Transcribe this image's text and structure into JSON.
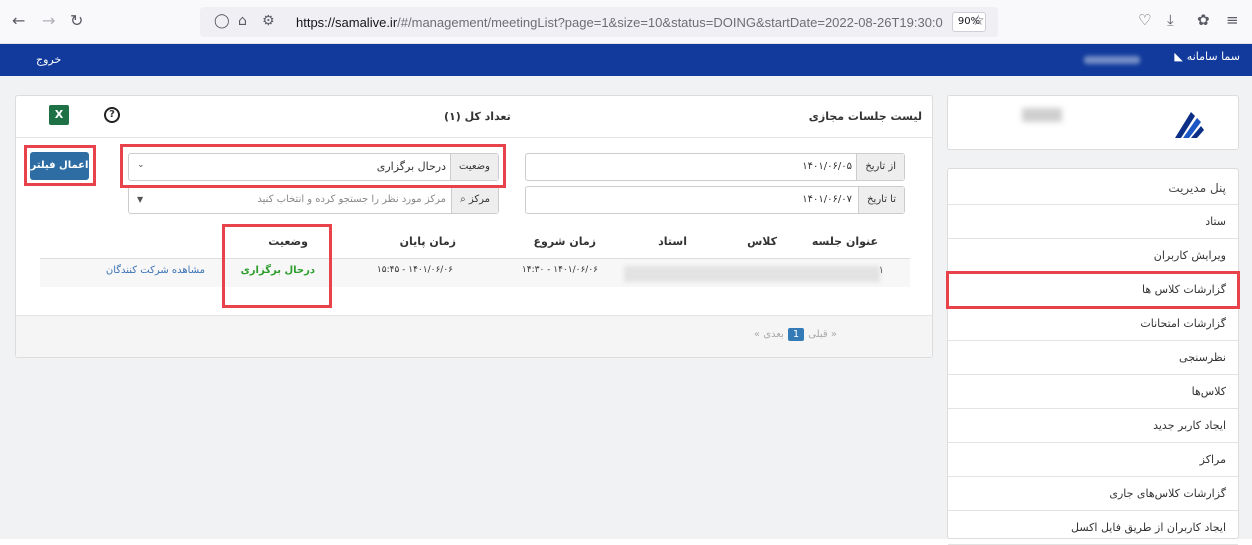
{
  "browser": {
    "url_host": "https://samalive.ir",
    "url_rest": "/#/management/meetingList?page=1&size=10&status=DOING&startDate=2022-08-26T19:30:0",
    "zoom": "90%"
  },
  "topbar": {
    "logout": "خروج",
    "brand": "سما سامانه"
  },
  "sidebar": {
    "items": [
      {
        "label": "پنل مدیریت"
      },
      {
        "label": "ستاد"
      },
      {
        "label": "ویرایش کاربران"
      },
      {
        "label": "گزارشات کلاس ها"
      },
      {
        "label": "گزارشات امتحانات"
      },
      {
        "label": "نظرسنجی"
      },
      {
        "label": "کلاس‌ها"
      },
      {
        "label": "ایجاد کاربر جدید"
      },
      {
        "label": "مراکز"
      },
      {
        "label": "گزارشات کلاس‌های جاری"
      },
      {
        "label": "ایجاد کاربران از طریق فایل اکسل"
      }
    ]
  },
  "panel": {
    "title": "لیست جلسات مجازی",
    "count": "تعداد کل (۱)",
    "excel_icon": "X",
    "help_icon": "?"
  },
  "filters": {
    "from_label": "از تاریخ",
    "from_value": "۱۴۰۱/۰۶/۰۵",
    "to_label": "تا تاریخ",
    "to_value": "۱۴۰۱/۰۶/۰۷",
    "status_label": "وضعیت",
    "status_value": "درحال برگزاری",
    "center_label": "مرکز",
    "center_placeholder": "مرکز مورد نظر را جستجو کرده و انتخاب کنید",
    "apply": "اعمال فیلتر"
  },
  "table": {
    "headers": [
      "عنوان جلسه",
      "کلاس",
      "استاد",
      "زمان شروع",
      "زمان پایان",
      "وضعیت"
    ],
    "rows": [
      {
        "index": "۱",
        "start": "۱۴:۳۰ - ۱۴۰۱/۰۶/۰۶",
        "end": "۱۵:۴۵ - ۱۴۰۱/۰۶/۰۶",
        "status": "درحال برگزاری",
        "action": "مشاهده شرکت کنندگان"
      }
    ]
  },
  "pager": {
    "prev": "« قبلی",
    "current": "1",
    "next": "بعدی »"
  },
  "colors": {
    "topbar": "#113a9c",
    "highlight": "#e8434a",
    "status": "#2a9d2a",
    "button": "#2e6da4"
  }
}
